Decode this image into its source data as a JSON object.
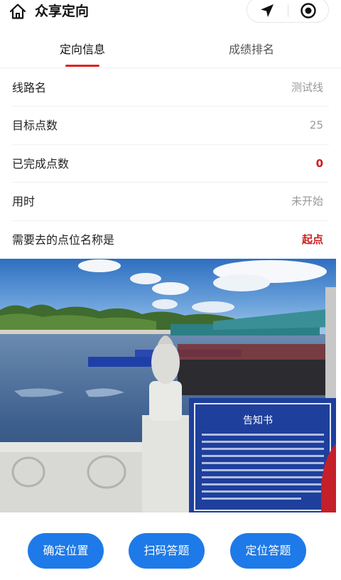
{
  "app": {
    "title": "众享定向"
  },
  "tabs": [
    {
      "label": "定向信息",
      "active": true
    },
    {
      "label": "成绩排名",
      "active": false
    }
  ],
  "info": [
    {
      "label": "线路名",
      "value": "测试线"
    },
    {
      "label": "目标点数",
      "value": "25"
    },
    {
      "label": "已完成点数",
      "value": "0"
    },
    {
      "label": "用时",
      "value": "未开始"
    },
    {
      "label": "需要去的点位名称是",
      "value": "起点"
    }
  ],
  "photo": {
    "sign_title": "告知书"
  },
  "actions": {
    "confirm_location": "确定位置",
    "scan_answer": "扫码答题",
    "locate_answer": "定位答题"
  },
  "colors": {
    "accent": "#e02020",
    "primary_button": "#1e7ae8",
    "highlight_value": "#cc1c1c"
  }
}
